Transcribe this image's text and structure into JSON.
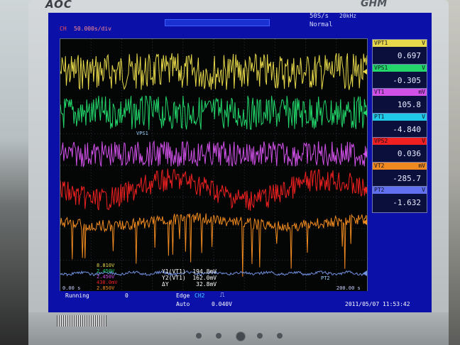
{
  "monitor": {
    "brand": "AOC",
    "model": "GHM"
  },
  "colors": {
    "ch1": "#e6d84a",
    "ch2": "#22d66a",
    "ch3": "#d050e8",
    "ch4": "#f02020",
    "ch5": "#f08a20",
    "screen": "#0b10a8"
  },
  "header": {
    "sample_rate": "50S/s",
    "mode": "Normal",
    "top_left": "50.000s/div",
    "ch_marker": "CH",
    "right_label": "20kHz"
  },
  "plot": {
    "vps1_label": "VPS1",
    "pt2_label": "PT2",
    "left_time": "0.00 s",
    "right_time": "200.00 s"
  },
  "cursor": {
    "y1_label": "Y1(VT1)",
    "y1_value": "194.8mV",
    "y2_label": "Y2(VT1)",
    "y2_value": "162.0mV",
    "dy_label": "ΔY",
    "dy_value": "32.8mV",
    "left_vals": [
      "8.810V",
      "2.450V",
      "2.450V",
      "438.0mV",
      "2.850V"
    ]
  },
  "measurements": [
    {
      "name": "VPT1",
      "unit": "V",
      "value": "0.697",
      "color": "#e6d84a"
    },
    {
      "name": "VPS1",
      "unit": "V",
      "value": "-0.305",
      "color": "#22d66a"
    },
    {
      "name": "VT1",
      "unit": "mV",
      "value": "105.8",
      "color": "#d050e8"
    },
    {
      "name": "PT1",
      "unit": "V",
      "value": "-4.840",
      "color": "#20c8e8"
    },
    {
      "name": "VPS2",
      "unit": "V",
      "value": "0.036",
      "color": "#f02020"
    },
    {
      "name": "VT2",
      "unit": "mV",
      "value": "-285.7",
      "color": "#f08a20"
    },
    {
      "name": "PT2",
      "unit": "V",
      "value": "-1.632",
      "color": "#6070f0"
    }
  ],
  "status": {
    "state": "Running",
    "count": "0",
    "trigger_label": "Edge",
    "trigger_ch": "CH2",
    "trigger_mode": "Auto",
    "trigger_level": "0.040V",
    "datetime": "2011/05/07 11:53:42"
  }
}
